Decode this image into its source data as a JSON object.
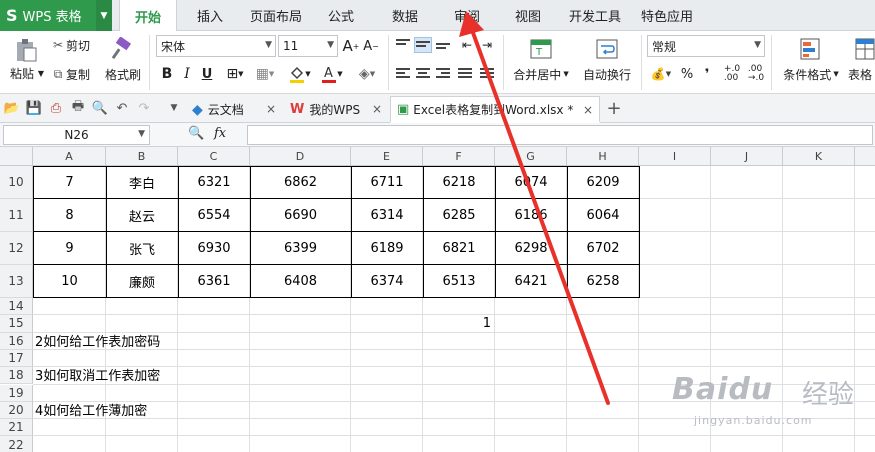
{
  "app": {
    "name": "WPS 表格"
  },
  "menu": [
    "开始",
    "插入",
    "页面布局",
    "公式",
    "数据",
    "审阅",
    "视图",
    "开发工具",
    "特色应用"
  ],
  "ribbon": {
    "paste": "粘贴",
    "cut": "剪切",
    "copy": "复制",
    "format_painter": "格式刷",
    "font_name": "宋体",
    "font_size": "11",
    "bold": "B",
    "italic": "I",
    "underline": "U",
    "merge_center": "合并居中",
    "wrap_text": "自动换行",
    "number_format": "常规",
    "percent": "%",
    "comma": "❜",
    "cond_format": "条件格式",
    "table_style": "表格"
  },
  "doctabs": [
    {
      "label": "云文档"
    },
    {
      "label": "我的WPS"
    },
    {
      "label": "Excel表格复制到Word.xlsx *"
    }
  ],
  "formula_bar": {
    "name_box": "N26",
    "fx": "fx",
    "value": ""
  },
  "columns": [
    "A",
    "B",
    "C",
    "D",
    "E",
    "F",
    "G",
    "H",
    "I",
    "J",
    "K"
  ],
  "table_rows": [
    {
      "row": "10",
      "cells": [
        "7",
        "李白",
        "6321",
        "6862",
        "6711",
        "6218",
        "6074",
        "6209"
      ]
    },
    {
      "row": "11",
      "cells": [
        "8",
        "赵云",
        "6554",
        "6690",
        "6314",
        "6285",
        "6186",
        "6064"
      ]
    },
    {
      "row": "12",
      "cells": [
        "9",
        "张飞",
        "6930",
        "6399",
        "6189",
        "6821",
        "6298",
        "6702"
      ]
    },
    {
      "row": "13",
      "cells": [
        "10",
        "廉颇",
        "6361",
        "6408",
        "6374",
        "6513",
        "6421",
        "6258"
      ]
    }
  ],
  "plain_rows": [
    "14",
    "15",
    "16",
    "17",
    "18",
    "19",
    "20",
    "21",
    "22"
  ],
  "f15_value": "1",
  "notes": {
    "r16": "2如何给工作表加密码",
    "r18": "3如何取消工作表加密",
    "r20": "4如何给工作薄加密"
  },
  "watermark": {
    "brand": "Baidu",
    "jy": "经验",
    "url": "jingyan.baidu.com"
  },
  "colors": {
    "accent": "#2f9a4c",
    "arrow": "#e8312a"
  }
}
